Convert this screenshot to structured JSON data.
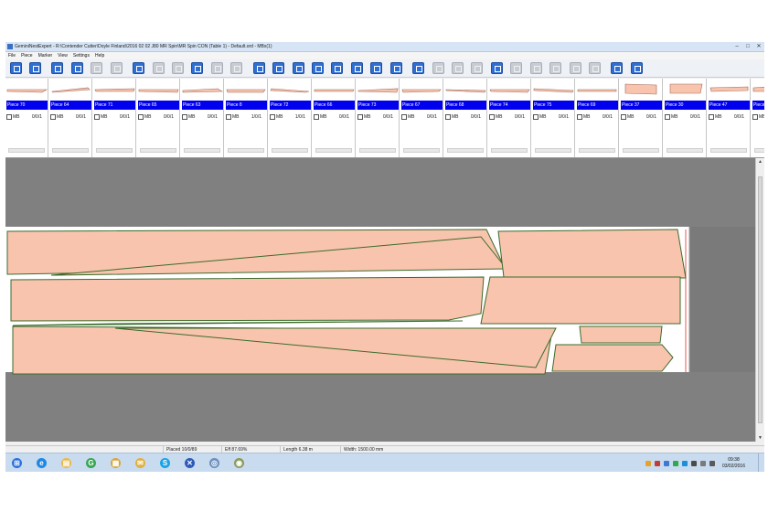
{
  "window": {
    "title": "GeminiNestExpert - R:\\Contender Cutter\\Doyle Finland\\2016 02 02 J80 MR Spin\\MR Spin CON (Table 1) - Default.ord - MBx(1)",
    "minimize": "–",
    "maximize": "□",
    "close": "✕"
  },
  "menu": [
    "File",
    "Piece",
    "Marker",
    "View",
    "Settings",
    "Help"
  ],
  "toolbar": {
    "buttons": [
      {
        "icon": "open-folder-icon",
        "state": "active"
      },
      {
        "icon": "save-icon",
        "state": "active"
      },
      {
        "icon": "grid-icon",
        "state": "active"
      },
      {
        "icon": "window-icon",
        "state": "active"
      },
      {
        "icon": "undo-icon",
        "state": "inactive"
      },
      {
        "icon": "redo-icon",
        "state": "inactive"
      },
      {
        "icon": "move-arrow-icon",
        "state": "active"
      },
      {
        "icon": "flip-icon",
        "state": "inactive"
      },
      {
        "icon": "rotate-icon",
        "state": "inactive"
      },
      {
        "icon": "piece-person-icon",
        "state": "active"
      },
      {
        "icon": "copy-icon",
        "state": "inactive"
      },
      {
        "icon": "duplicate-icon",
        "state": "inactive"
      },
      {
        "icon": "pen-icon",
        "state": "active"
      },
      {
        "icon": "scale-icon",
        "state": "active"
      },
      {
        "icon": "align-icon",
        "state": "active"
      },
      {
        "icon": "list-icon",
        "state": "active"
      },
      {
        "icon": "delete-x-icon",
        "state": "active"
      },
      {
        "icon": "notch-icon",
        "state": "active"
      },
      {
        "icon": "shield-icon",
        "state": "active"
      },
      {
        "icon": "wrench-icon",
        "state": "active"
      },
      {
        "icon": "table-icon",
        "state": "active"
      },
      {
        "icon": "nest-a-icon",
        "state": "inactive"
      },
      {
        "icon": "nest-b-icon",
        "state": "inactive"
      },
      {
        "icon": "nest-c-icon",
        "state": "inactive"
      },
      {
        "icon": "add-cross-icon",
        "state": "active"
      },
      {
        "icon": "layout-a-icon",
        "state": "inactive"
      },
      {
        "icon": "layout-b-icon",
        "state": "inactive"
      },
      {
        "icon": "clock-icon",
        "state": "inactive"
      },
      {
        "icon": "layout-c-icon",
        "state": "inactive"
      },
      {
        "icon": "layout-d-icon",
        "state": "inactive"
      },
      {
        "icon": "zoom-icon",
        "state": "active"
      },
      {
        "icon": "measure-icon",
        "state": "active"
      }
    ]
  },
  "pieces": [
    {
      "label": "Piece 70",
      "flag": "MB",
      "count": "0/0/1"
    },
    {
      "label": "Piece 64",
      "flag": "MB",
      "count": "0/0/1"
    },
    {
      "label": "Piece 71",
      "flag": "MB",
      "count": "0/0/1"
    },
    {
      "label": "Piece 65",
      "flag": "MB",
      "count": "0/0/1"
    },
    {
      "label": "Piece 63",
      "flag": "MB",
      "count": "0/0/1"
    },
    {
      "label": "Piece 8",
      "flag": "MB",
      "count": "1/0/1"
    },
    {
      "label": "Piece 72",
      "flag": "MB",
      "count": "1/0/1"
    },
    {
      "label": "Piece 66",
      "flag": "MB",
      "count": "0/0/1"
    },
    {
      "label": "Piece 73",
      "flag": "MB",
      "count": "0/0/1"
    },
    {
      "label": "Piece 67",
      "flag": "MB",
      "count": "0/0/1"
    },
    {
      "label": "Piece 68",
      "flag": "MB",
      "count": "0/0/1"
    },
    {
      "label": "Piece 74",
      "flag": "MB",
      "count": "0/0/1"
    },
    {
      "label": "Piece 75",
      "flag": "MB",
      "count": "0/0/1"
    },
    {
      "label": "Piece 69",
      "flag": "MB",
      "count": "0/0/1"
    },
    {
      "label": "Piece 37",
      "flag": "MB",
      "count": "0/0/1"
    },
    {
      "label": "Piece 30",
      "flag": "MB",
      "count": "0/0/1"
    },
    {
      "label": "Piece 47",
      "flag": "MB",
      "count": "0/0/1"
    },
    {
      "label": "Piece",
      "flag": "MB",
      "count": ""
    }
  ],
  "status": {
    "placed": "Placed 10/0/89",
    "efficiency": "Eff 87.69%",
    "length": "Length 6.38 m",
    "width": "Width: 1500.00 mm"
  },
  "taskbar": {
    "apps": [
      {
        "icon": "windows-start-icon",
        "glyph": "⊞",
        "color": "#2a6fdb"
      },
      {
        "icon": "internet-explorer-icon",
        "glyph": "e",
        "color": "#1e88e5"
      },
      {
        "icon": "file-explorer-icon",
        "glyph": "▤",
        "color": "#e8b84a"
      },
      {
        "icon": "green-app-icon",
        "glyph": "G",
        "color": "#3aa655"
      },
      {
        "icon": "notes-icon",
        "glyph": "▦",
        "color": "#d7a53a"
      },
      {
        "icon": "mail-icon",
        "glyph": "✉",
        "color": "#e0b040"
      },
      {
        "icon": "skype-icon",
        "glyph": "S",
        "color": "#1ca3e6"
      },
      {
        "icon": "nest-app-icon",
        "glyph": "✕",
        "color": "#2f59b8"
      },
      {
        "icon": "media-icon",
        "glyph": "◎",
        "color": "#6c8fbf"
      },
      {
        "icon": "chrome-icon",
        "glyph": "◉",
        "color": "#8a9a5a"
      }
    ],
    "time": "09:38",
    "date": "03/02/2016"
  },
  "colors": {
    "piece_fill": "#f9c4ae",
    "piece_outline": "#3a6b2a",
    "selected_label": "#0000ee",
    "canvas_bg": "#808080",
    "marker_bg": "#ffffff",
    "end_line": "#e03030"
  }
}
